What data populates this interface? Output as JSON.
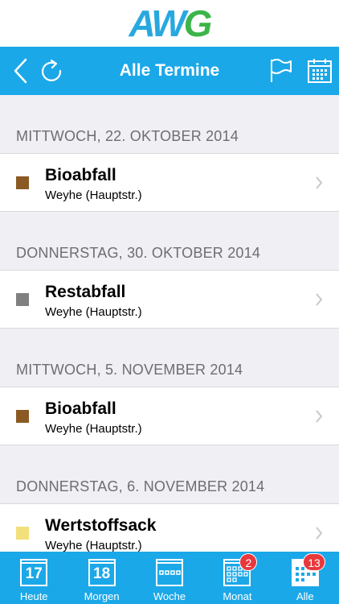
{
  "logo": {
    "text_a": "A",
    "text_w": "W",
    "text_g": "G"
  },
  "navbar": {
    "title": "Alle Termine"
  },
  "sections": [
    {
      "header": "MITTWOCH, 22. OKTOBER 2014",
      "item": {
        "title": "Bioabfall",
        "location": "Weyhe (Hauptstr.)",
        "color": "#8b5a24"
      }
    },
    {
      "header": "DONNERSTAG, 30. OKTOBER 2014",
      "item": {
        "title": "Restabfall",
        "location": "Weyhe (Hauptstr.)",
        "color": "#808080"
      }
    },
    {
      "header": "MITTWOCH, 5. NOVEMBER 2014",
      "item": {
        "title": "Bioabfall",
        "location": "Weyhe (Hauptstr.)",
        "color": "#8b5a24"
      }
    },
    {
      "header": "DONNERSTAG, 6. NOVEMBER 2014",
      "item": {
        "title": "Wertstoffsack",
        "location": "Weyhe (Hauptstr.)",
        "color": "#f2e07a"
      }
    }
  ],
  "tabs": [
    {
      "label": "Heute",
      "number": "17",
      "icon": "calendar-day-icon"
    },
    {
      "label": "Morgen",
      "number": "18",
      "icon": "calendar-day-icon"
    },
    {
      "label": "Woche",
      "icon": "calendar-week-icon"
    },
    {
      "label": "Monat",
      "icon": "calendar-month-icon",
      "badge": "2"
    },
    {
      "label": "Alle",
      "icon": "calendar-all-icon",
      "badge": "13",
      "active": true
    }
  ],
  "colors": {
    "accent": "#1ba8e8",
    "badge": "#e8383d",
    "logo_blue": "#29a8e0",
    "logo_green": "#3cb54a"
  }
}
